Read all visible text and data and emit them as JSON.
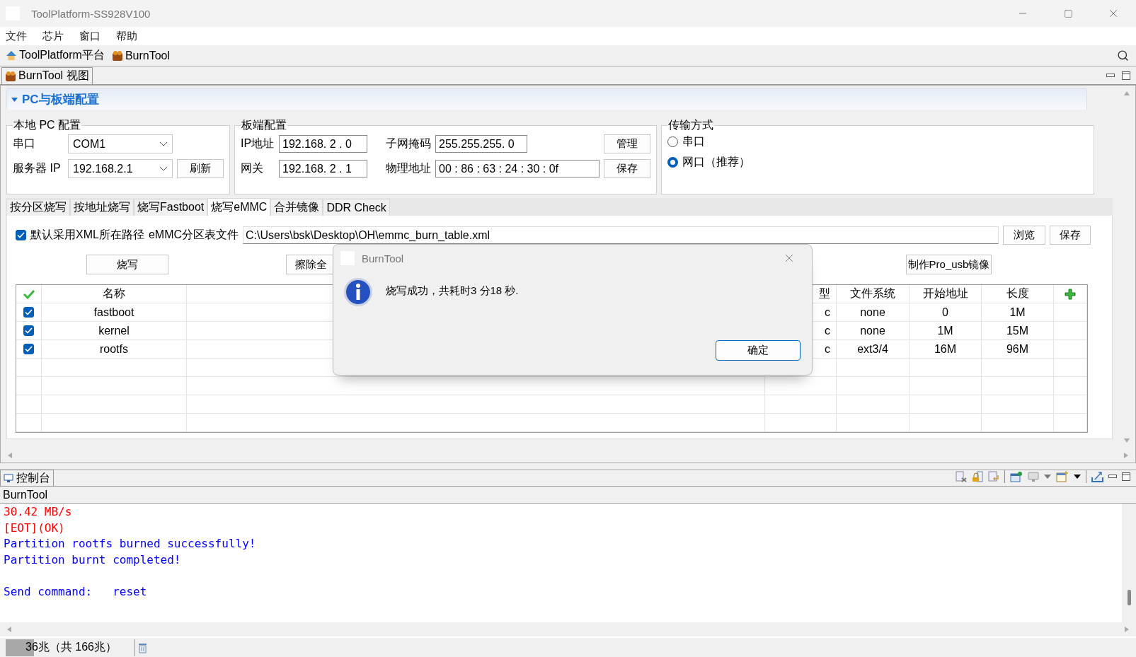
{
  "window": {
    "title": "ToolPlatform-SS928V100"
  },
  "menu": [
    "文件",
    "芯片",
    "窗口",
    "帮助"
  ],
  "toolbar": [
    {
      "label": "ToolPlatform平台",
      "kind": "home"
    },
    {
      "label": "BurnTool",
      "kind": "burn"
    }
  ],
  "view_tab": "BurnTool 视图",
  "section": {
    "title": "PC与板端配置",
    "expanded": true
  },
  "local_pc": {
    "title": "本地 PC 配置",
    "serial_label": "串口",
    "serial_value": "COM1",
    "server_ip_label": "服务器 IP",
    "server_ip_value": "192.168.2.1",
    "refresh_button": "刷新"
  },
  "board": {
    "title": "板端配置",
    "ip_label": "IP地址",
    "ip_value": "192.168. 2 . 0",
    "mask_label": "子网掩码",
    "mask_value": "255.255.255. 0",
    "gateway_label": "网关",
    "gateway_value": "192.168. 2 . 1",
    "mac_label": "物理地址",
    "mac_value": "00 : 86 : 63 : 24 : 30 : 0f",
    "manage_button": "管理",
    "save_button": "保存"
  },
  "transfer": {
    "title": "传输方式",
    "options": [
      {
        "label": "串口",
        "selected": false
      },
      {
        "label": "网口（推荐）",
        "selected": true
      }
    ]
  },
  "tabs": [
    {
      "label": "按分区烧写",
      "selected": false
    },
    {
      "label": "按地址烧写",
      "selected": false
    },
    {
      "label": "烧写Fastboot",
      "selected": false
    },
    {
      "label": "烧写eMMC",
      "selected": true
    },
    {
      "label": "合并镜像",
      "selected": false
    },
    {
      "label": "DDR Check",
      "selected": false
    }
  ],
  "emmc": {
    "use_xml_path": {
      "label": "默认采用XML所在路径",
      "checked": true
    },
    "table_file_label": "eMMC分区表文件",
    "table_file_value": "C:\\Users\\bsk\\Desktop\\OH\\emmc_burn_table.xml",
    "browse_button": "浏览",
    "save_button": "保存",
    "burn_button": "烧写",
    "erase_button": "擦除全",
    "usb_image_button": "制作Pro_usb镜像"
  },
  "partition_table": {
    "columns": {
      "name": "名称",
      "type": "型",
      "filesystem": "文件系统",
      "start": "开始地址",
      "length": "长度"
    },
    "rows": [
      {
        "checked": true,
        "name": "fastboot",
        "type": "c",
        "filesystem": "none",
        "start": "0",
        "length": "1M"
      },
      {
        "checked": true,
        "name": "kernel",
        "type": "c",
        "filesystem": "none",
        "start": "1M",
        "length": "15M"
      },
      {
        "checked": true,
        "name": "rootfs",
        "type": "c",
        "filesystem": "ext3/4",
        "start": "16M",
        "length": "96M"
      }
    ]
  },
  "dialog": {
    "title": "BurnTool",
    "message": "烧写成功，共耗时3 分18 秒.",
    "ok_button": "确定"
  },
  "console": {
    "tab": "控制台",
    "source": "BurnTool",
    "blocks": [
      {
        "lines": [
          {
            "text": "30.42 MB/s",
            "color": "#ff0000"
          },
          {
            "text": "[EOT](OK)",
            "color": "#ff0000"
          },
          {
            "text": "Partition rootfs burned successfully!",
            "color": "#0000ff"
          },
          {
            "text": "Partition burnt completed!",
            "color": "#0000ff"
          }
        ]
      },
      {
        "lines": [
          {
            "text": "Send command:   reset",
            "color": "#0000ff"
          }
        ]
      }
    ]
  },
  "status": {
    "text": "36兆（共 166兆）",
    "level": 0.22
  }
}
